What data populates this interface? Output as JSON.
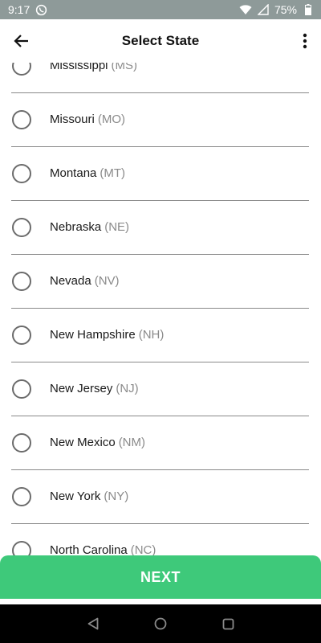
{
  "status_bar": {
    "time": "9:17",
    "battery": "75%"
  },
  "app_bar": {
    "title": "Select State"
  },
  "states": [
    {
      "name": "Mississippi",
      "abbr": "(MS)"
    },
    {
      "name": "Missouri",
      "abbr": "(MO)"
    },
    {
      "name": "Montana",
      "abbr": "(MT)"
    },
    {
      "name": "Nebraska",
      "abbr": "(NE)"
    },
    {
      "name": "Nevada",
      "abbr": "(NV)"
    },
    {
      "name": "New Hampshire",
      "abbr": "(NH)"
    },
    {
      "name": "New Jersey",
      "abbr": "(NJ)"
    },
    {
      "name": "New Mexico",
      "abbr": "(NM)"
    },
    {
      "name": "New York",
      "abbr": "(NY)"
    },
    {
      "name": "North Carolina",
      "abbr": "(NC)"
    }
  ],
  "footer": {
    "next_label": "NEXT"
  },
  "colors": {
    "status_bar": "#8e9a99",
    "next_button": "#3ec97a",
    "nav_bar": "#000000"
  }
}
